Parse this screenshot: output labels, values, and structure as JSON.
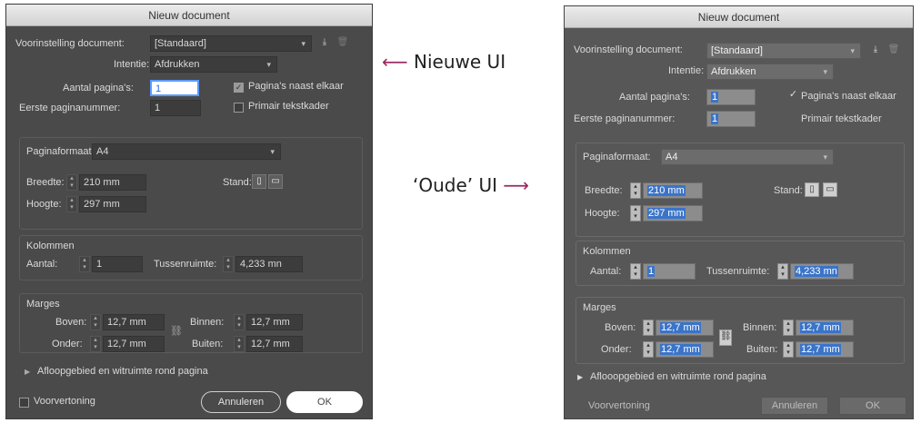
{
  "new_dialog": {
    "title": "Nieuw document",
    "preset_label": "Voorinstelling document:",
    "preset_value": "[Standaard]",
    "intent_label": "Intentie:",
    "intent_value": "Afdrukken",
    "pages_label": "Aantal pagina's:",
    "pages_value": "1",
    "first_page_label": "Eerste paginanummer:",
    "first_page_value": "1",
    "facing_pages_label": "Pagina's naast elkaar",
    "facing_pages_checked": true,
    "primary_frame_label": "Primair tekstkader",
    "primary_frame_checked": false,
    "page_size_label": "Paginaformaat:",
    "page_size_value": "A4",
    "width_label": "Breedte:",
    "width_value": "210 mm",
    "height_label": "Hoogte:",
    "height_value": "297 mm",
    "orientation_label": "Stand:",
    "columns_title": "Kolommen",
    "columns_count_label": "Aantal:",
    "columns_count_value": "1",
    "gutter_label": "Tussenruimte:",
    "gutter_value": "4,233 mn",
    "margins_title": "Marges",
    "top_label": "Boven:",
    "top_value": "12,7 mm",
    "bottom_label": "Onder:",
    "bottom_value": "12,7 mm",
    "inside_label": "Binnen:",
    "inside_value": "12,7 mm",
    "outside_label": "Buiten:",
    "outside_value": "12,7 mm",
    "bleed_label": "Afloopgebied en witruimte rond pagina",
    "preview_label": "Voorvertoning",
    "cancel_label": "Annuleren",
    "ok_label": "OK"
  },
  "old_dialog": {
    "title": "Nieuw document",
    "preset_label": "Voorinstelling document:",
    "preset_value": "[Standaard]",
    "intent_label": "Intentie:",
    "intent_value": "Afdrukken",
    "pages_label": "Aantal pagina's:",
    "pages_value": "1",
    "first_page_label": "Eerste paginanummer:",
    "first_page_value": "1",
    "facing_pages_label": "Pagina's naast elkaar",
    "primary_frame_label": "Primair tekstkader",
    "page_size_label": "Paginaformaat:",
    "page_size_value": "A4",
    "width_label": "Breedte:",
    "width_value": "210 mm",
    "height_label": "Hoogte:",
    "height_value": "297 mm",
    "orientation_label": "Stand:",
    "columns_title": "Kolommen",
    "columns_count_label": "Aantal:",
    "columns_count_value": "1",
    "gutter_label": "Tussenruimte:",
    "gutter_value": "4,233 mn",
    "margins_title": "Marges",
    "top_label": "Boven:",
    "top_value": "12,7 mm",
    "bottom_label": "Onder:",
    "bottom_value": "12,7 mm",
    "inside_label": "Binnen:",
    "inside_value": "12,7 mm",
    "outside_label": "Buiten:",
    "outside_value": "12,7 mm",
    "bleed_label": "Aflooopgebied en witruimte rond pagina",
    "preview_label": "Voorvertoning",
    "cancel_label": "Annuleren",
    "ok_label": "OK"
  },
  "annotations": {
    "new_ui": "Nieuwe UI",
    "old_ui": "‘Oude’ UI",
    "arrow_color": "#9a2a61"
  }
}
